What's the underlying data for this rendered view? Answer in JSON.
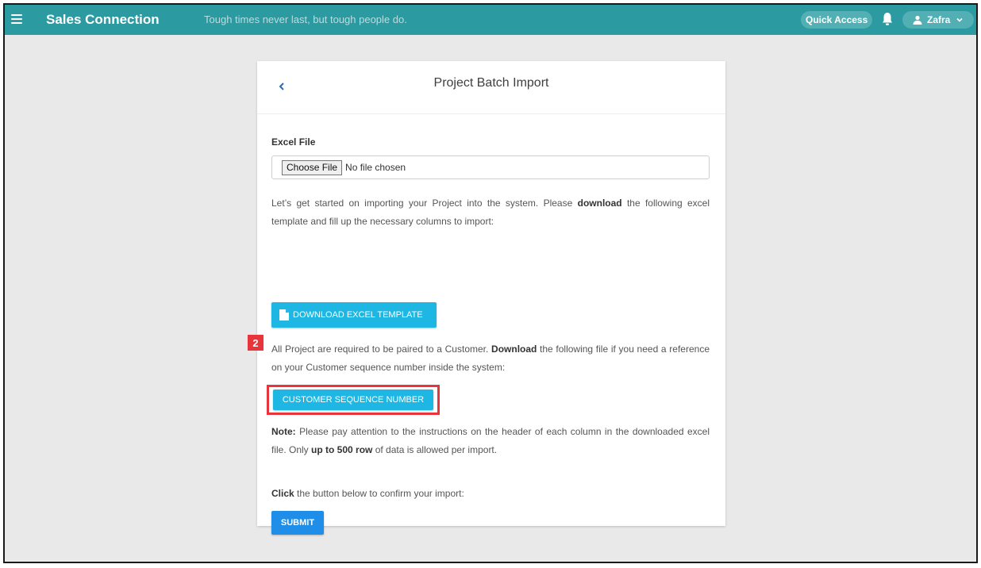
{
  "topbar": {
    "app_title": "Sales Connection",
    "tagline": "Tough times never last, but tough people do.",
    "quick_access": "Quick Access",
    "user_name": "Zafra",
    "color": "#2c9aa1"
  },
  "card": {
    "title": "Project Batch Import",
    "excel_label": "Excel File",
    "choose_file_label": "Choose File",
    "no_file_text": "No file chosen",
    "intro": {
      "before": "Let’s get started on importing your Project into the system. Please ",
      "bold": "download",
      "after": " the following excel template and fill up the necessary columns to import:"
    },
    "download_template_label": "DOWNLOAD EXCEL TEMPLATE",
    "pairing": {
      "before": "All Project are required to be paired to a Customer. ",
      "bold": "Download",
      "after": " the following file if you need a reference on your Customer sequence number inside the system:"
    },
    "customer_seq_label": "CUSTOMER SEQUENCE NUMBER",
    "note": {
      "bold1": "Note:",
      "text1": " Please pay attention to the instructions on the header of each column in the downloaded excel file. Only ",
      "bold2": "up to 500 row",
      "text2": " of data is allowed per import."
    },
    "confirm": {
      "bold": "Click",
      "text": " the button below to confirm your import:"
    },
    "submit_label": "SUBMIT"
  },
  "annotation": {
    "step_number": "2",
    "highlight_color": "#e8343b"
  }
}
